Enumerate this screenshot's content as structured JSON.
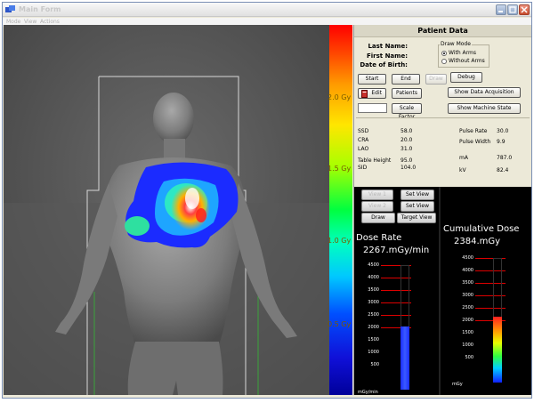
{
  "window": {
    "title": "Main Form",
    "menu": [
      "Mode",
      "View",
      "Actions"
    ]
  },
  "colors": {
    "panel_bg": "#ece9d8",
    "dose_bar_blue": "#1a2cff",
    "scale_label": "#7a5a00"
  },
  "scale": {
    "labels": [
      "2.0 Gy",
      "1.5 Gy",
      "1.0 Gy",
      "0.5 Gy"
    ]
  },
  "patient": {
    "header": "Patient Data",
    "last_name_label": "Last Name:",
    "first_name_label": "First Name:",
    "dob_label": "Date of Birth:",
    "draw_mode": {
      "title": "Draw Mode",
      "options": [
        "With Arms",
        "Without Arms"
      ],
      "selected": "With Arms"
    }
  },
  "buttons": {
    "start": "Start",
    "end": "End",
    "draw": "Draw",
    "debug": "Debug",
    "edit": "Edit",
    "patients": "Patients",
    "show_data_acquisition": "Show Data Acquisition",
    "scale_factor": "Scale Factor",
    "show_machine_state": "Show Machine State"
  },
  "params": {
    "left": [
      {
        "label": "SSD",
        "value": "58.0"
      },
      {
        "label": "CRA",
        "value": "20.0"
      },
      {
        "label": "LAO",
        "value": "31.0"
      },
      {
        "label": "Table Height",
        "value": "95.0"
      },
      {
        "label": "SID",
        "value": "104.0"
      }
    ],
    "right": [
      {
        "label": "Pulse Rate",
        "value": "30.0"
      },
      {
        "label": "Pulse Width",
        "value": "9.9"
      },
      {
        "label": "mA",
        "value": "787.0"
      },
      {
        "label": "kV",
        "value": "82.4"
      }
    ]
  },
  "view_buttons": {
    "view1": "View 1",
    "set_view_1": "Set View",
    "view2": "View 2",
    "set_view_2": "Set View",
    "draw_gantry": "Draw Gantry",
    "target_view_on": "Target View On"
  },
  "dose_rate": {
    "title": "Dose Rate",
    "value": "2267.mGy/min",
    "ticks": [
      "4500",
      "4000",
      "3500",
      "3000",
      "2500",
      "2000",
      "1500",
      "1000",
      "500"
    ],
    "unit": "mGy/min",
    "bar_fraction": 0.504
  },
  "cumulative_dose": {
    "title": "Cumulative Dose",
    "value": "2384.mGy",
    "ticks": [
      "4500",
      "4000",
      "3500",
      "3000",
      "2500",
      "2000",
      "1500",
      "1000",
      "500"
    ],
    "unit": "mGy",
    "bar_fraction": 0.53
  }
}
